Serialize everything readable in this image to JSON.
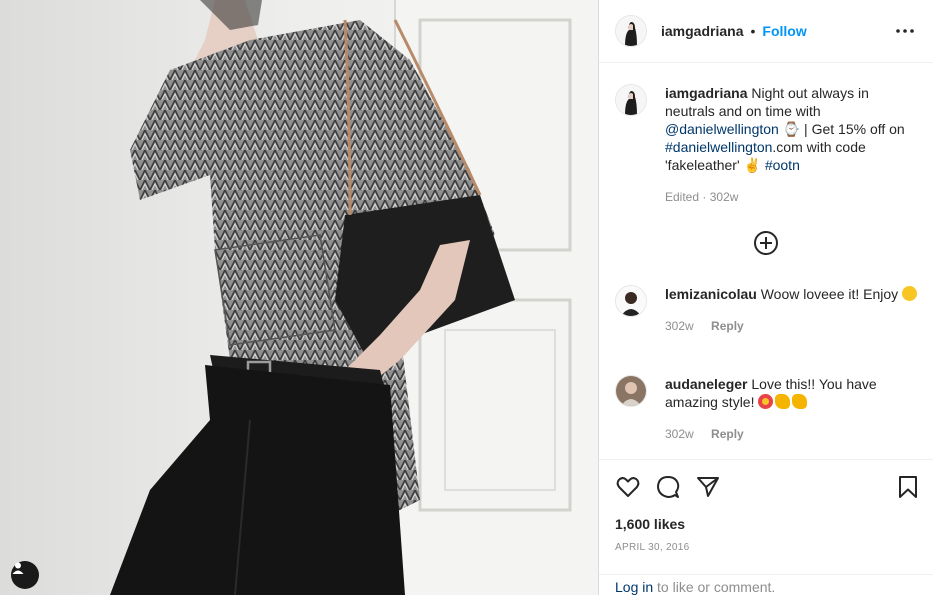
{
  "post": {
    "username": "iamgadriana",
    "separator": "•",
    "follow_label": "Follow",
    "caption": {
      "username": "iamgadriana",
      "text_1": " Night out always in neutrals and on time with ",
      "mention": "@danielwellington",
      "text_2": " ⌚ | Get 15% off on ",
      "hashtag_1": "#danielwellington",
      "text_3": ".com with code 'fakeleather' ✌️ ",
      "hashtag_2": "#ootn",
      "edited_label": "Edited",
      "separator": "·",
      "age": "302w"
    },
    "comments": [
      {
        "username": "lemizanicolau",
        "text": " Woow loveee it! Enjoy ",
        "age": "302w",
        "reply_label": "Reply"
      },
      {
        "username": "audaneleger",
        "text": " Love this!! You have amazing style! ",
        "age": "302w",
        "reply_label": "Reply"
      }
    ],
    "likes": "1,600 likes",
    "date": "APRIL 30, 2016",
    "login": {
      "link": "Log in",
      "text": " to like or comment."
    }
  },
  "icons": {
    "more": "more-options-icon",
    "load_more": "plus-circle-icon",
    "like": "heart-icon",
    "comment": "comment-icon",
    "share": "share-icon",
    "save": "bookmark-icon",
    "tagged": "user-tag-icon"
  },
  "colors": {
    "accent": "#0095f6",
    "link": "#00376b",
    "muted": "#8e8e8e",
    "text": "#262626"
  }
}
